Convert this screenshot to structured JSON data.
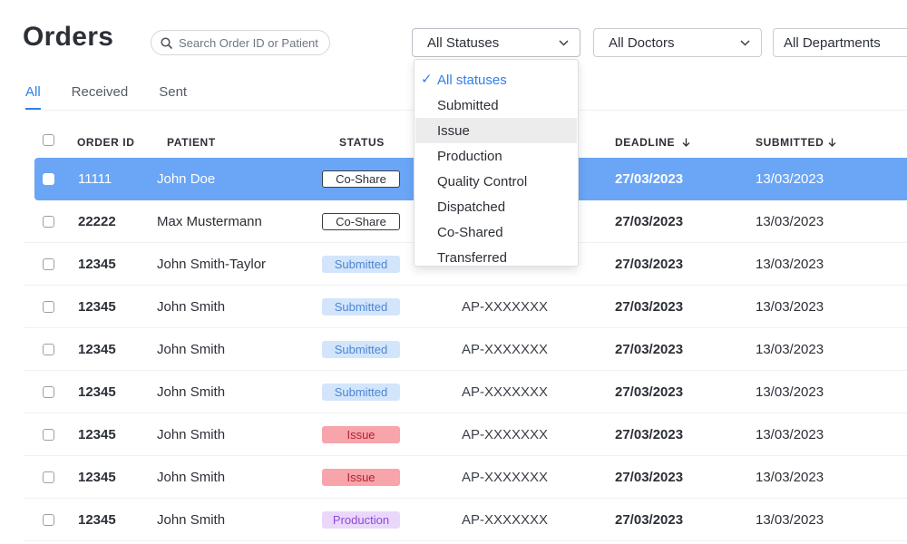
{
  "page": {
    "title": "Orders"
  },
  "search": {
    "placeholder": "Search Order ID or Patient"
  },
  "filters": {
    "status": "All Statuses",
    "doctors": "All Doctors",
    "departments": "All Departments"
  },
  "tabs": [
    {
      "label": "All",
      "active": true
    },
    {
      "label": "Received",
      "active": false
    },
    {
      "label": "Sent",
      "active": false
    }
  ],
  "table": {
    "headers": {
      "order_id": "ORDER ID",
      "patient": "PATIENT",
      "status": "STATUS",
      "deadline": "DEADLINE",
      "submitted": "SUBMITTED"
    },
    "rows": [
      {
        "order_id": "11111",
        "patient": "John Doe",
        "status": "Co-Share",
        "ref": "",
        "deadline": "27/03/2023",
        "submitted": "13/03/2023"
      },
      {
        "order_id": "22222",
        "patient": "Max Mustermann",
        "status": "Co-Share",
        "ref": "",
        "deadline": "27/03/2023",
        "submitted": "13/03/2023"
      },
      {
        "order_id": "12345",
        "patient": "John Smith-Taylor",
        "status": "Submitted",
        "ref": "",
        "deadline": "27/03/2023",
        "submitted": "13/03/2023"
      },
      {
        "order_id": "12345",
        "patient": "John Smith",
        "status": "Submitted",
        "ref": "AP-XXXXXXX",
        "deadline": "27/03/2023",
        "submitted": "13/03/2023"
      },
      {
        "order_id": "12345",
        "patient": "John Smith",
        "status": "Submitted",
        "ref": "AP-XXXXXXX",
        "deadline": "27/03/2023",
        "submitted": "13/03/2023"
      },
      {
        "order_id": "12345",
        "patient": "John Smith",
        "status": "Submitted",
        "ref": "AP-XXXXXXX",
        "deadline": "27/03/2023",
        "submitted": "13/03/2023"
      },
      {
        "order_id": "12345",
        "patient": "John Smith",
        "status": "Issue",
        "ref": "AP-XXXXXXX",
        "deadline": "27/03/2023",
        "submitted": "13/03/2023"
      },
      {
        "order_id": "12345",
        "patient": "John Smith",
        "status": "Issue",
        "ref": "AP-XXXXXXX",
        "deadline": "27/03/2023",
        "submitted": "13/03/2023"
      },
      {
        "order_id": "12345",
        "patient": "John Smith",
        "status": "Production",
        "ref": "AP-XXXXXXX",
        "deadline": "27/03/2023",
        "submitted": "13/03/2023"
      }
    ]
  },
  "status_dropdown": {
    "options": [
      {
        "label": "All statuses",
        "checked": true
      },
      {
        "label": "Submitted"
      },
      {
        "label": "Issue",
        "hovered": true
      },
      {
        "label": "Production"
      },
      {
        "label": "Quality Control"
      },
      {
        "label": "Dispatched"
      },
      {
        "label": "Co-Shared"
      },
      {
        "label": "Transferred"
      }
    ]
  },
  "colors": {
    "accent": "#2f80e8",
    "selected_row": "#6aa5f6",
    "submitted_badge": "#d3e5fb",
    "issue_badge": "#f7a4ab",
    "production_badge": "#ead8fb"
  },
  "icons": {
    "search": "search-icon",
    "chevron": "chevron-down-icon",
    "sort": "arrow-down-icon",
    "check": "checkmark-icon"
  }
}
